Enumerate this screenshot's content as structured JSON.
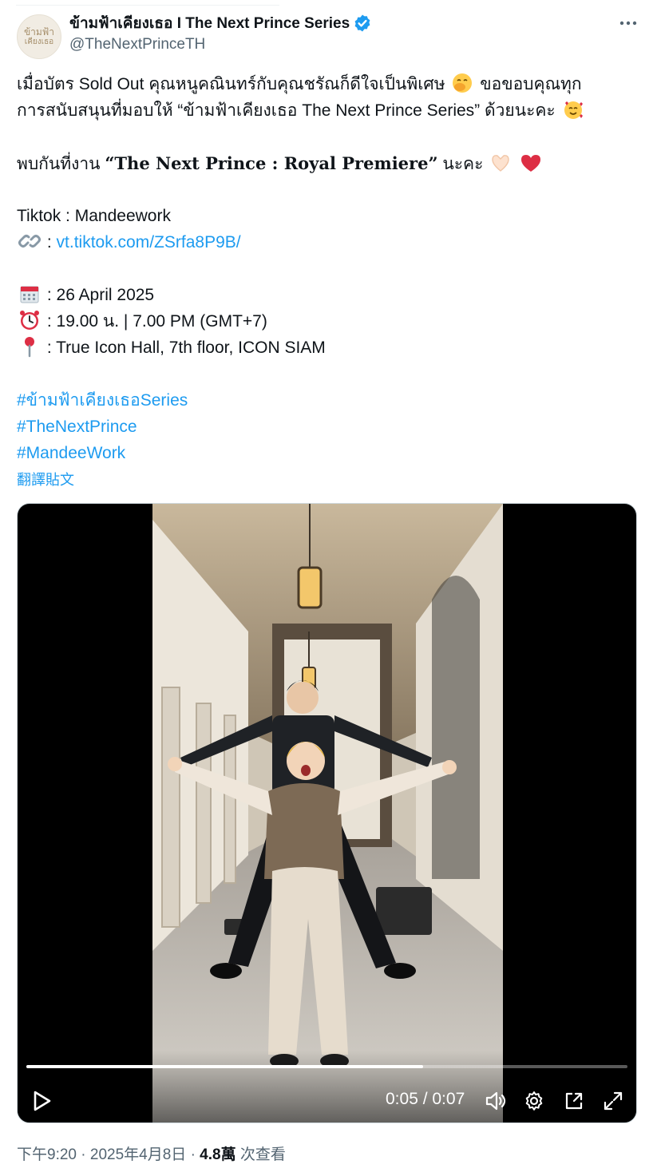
{
  "author": {
    "display_name": "ข้ามฟ้าเคียงเธอ I The Next Prince Series",
    "handle": "@TheNextPrinceTH",
    "avatar_text_line1": "ข้ามฟ้า",
    "avatar_text_line2": "เคียงเธอ",
    "verified": true
  },
  "icons": {
    "more": "more-horizontal-icon",
    "verified": "verified-badge-icon",
    "link": "link-icon",
    "calendar": "calendar-icon",
    "clock": "alarm-clock-icon",
    "pin": "pin-icon",
    "play": "play-icon",
    "volume": "volume-icon",
    "settings": "gear-icon",
    "pip": "picture-in-picture-icon",
    "fullscreen": "fullscreen-icon"
  },
  "tweet": {
    "line1": "เมื่อบัตร Sold Out คุณหนูคณินทร์กับคุณชรัณก็ดีใจเป็นพิเศษ",
    "line1b": "ขอขอบคุณทุก",
    "line2": "การสนับสนุนที่มอบให้ “ข้ามฟ้าเคียงเธอ The Next Prince Series” ด้วยนะคะ",
    "line3_prefix": "พบกันที่งาน",
    "line3_event": "“The Next Prince : Royal Premiere”",
    "line3_suffix": "นะคะ",
    "tiktok": "Tiktok : Mandeework",
    "link_prefix": ":",
    "link_url": "vt.tiktok.com/ZSrfa8P9B/",
    "date": ": 26 April 2025",
    "time": ": 19.00 น. | 7.00 PM (GMT+7)",
    "venue": ": True Icon Hall, 7th floor, ICON SIAM",
    "hashtags": [
      "#ข้ามฟ้าเคียงเธอSeries",
      "#TheNextPrince",
      "#MandeeWork"
    ],
    "translate": "翻譯貼文"
  },
  "video": {
    "current_time": "0:05",
    "duration": "0:07",
    "time_display": "0:05 / 0:07",
    "progress": 0.66
  },
  "meta": {
    "time": "下午9:20",
    "date": "2025年4月8日",
    "views": "4.8萬",
    "views_label": "次查看",
    "separator": "·"
  },
  "colors": {
    "link": "#1d9bf0",
    "text": "#0f1419",
    "secondary": "#536471",
    "verified": "#1d9bf0"
  }
}
